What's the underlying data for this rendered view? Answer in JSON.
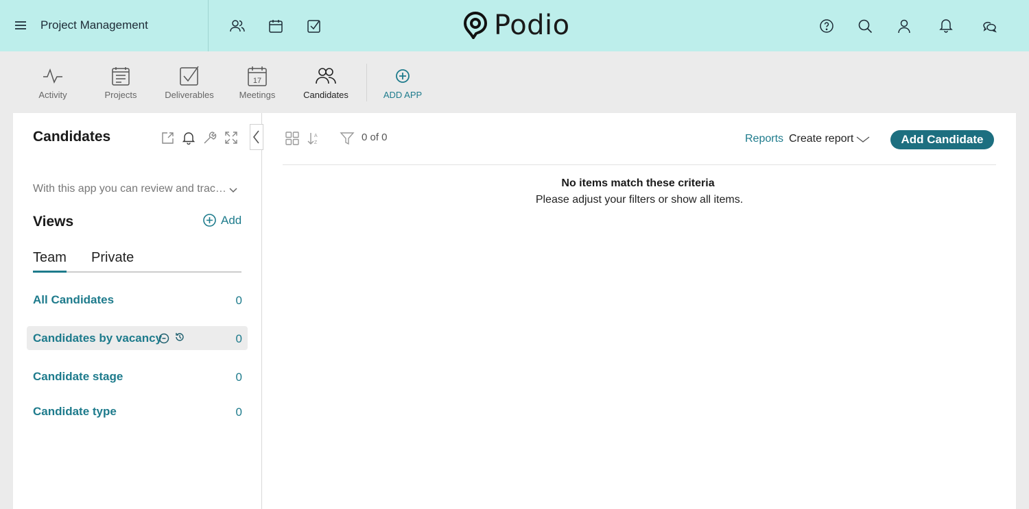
{
  "topbar": {
    "workspace_name": "Project Management",
    "logo_text": "Podio",
    "left_icons": [
      "contacts-icon",
      "calendar-icon",
      "tasks-icon"
    ],
    "right_icons": [
      "help-icon",
      "search-icon",
      "profile-icon",
      "notifications-icon",
      "chat-icon"
    ]
  },
  "apps": [
    {
      "label": "Activity",
      "icon": "activity-icon"
    },
    {
      "label": "Projects",
      "icon": "projects-icon"
    },
    {
      "label": "Deliverables",
      "icon": "deliverables-icon"
    },
    {
      "label": "Meetings",
      "icon": "meetings-calendar-icon",
      "icon_text": "17"
    },
    {
      "label": "Candidates",
      "icon": "candidates-icon",
      "active": true
    },
    {
      "label": "ADD APP",
      "icon": "add-circle-icon"
    }
  ],
  "sidebar": {
    "title": "Candidates",
    "tools": [
      "share-icon",
      "bell-icon",
      "wrench-icon",
      "expand-icon"
    ],
    "description": "With this app you can review and trac…",
    "views_heading": "Views",
    "views_add_label": "Add",
    "tabs": [
      {
        "label": "Team",
        "active": true
      },
      {
        "label": "Private",
        "active": false
      }
    ],
    "views": [
      {
        "label": "All Candidates",
        "count": "0"
      },
      {
        "label": "Candidates by vacancy",
        "count": "0",
        "selected": true
      },
      {
        "label": "Candidate stage",
        "count": "0"
      },
      {
        "label": "Candidate type",
        "count": "0"
      }
    ]
  },
  "content": {
    "item_count": "0 of 0",
    "reports_label": "Reports",
    "create_report_label": "Create report",
    "add_button_label": "Add Candidate",
    "empty_title": "No items match these criteria",
    "empty_subtitle": "Please adjust your filters or show all items."
  },
  "colors": {
    "topbar_bg": "#bdeeeb",
    "accent": "#1e7b8c",
    "primary_button": "#1d6f80",
    "page_bg": "#ebebeb"
  }
}
